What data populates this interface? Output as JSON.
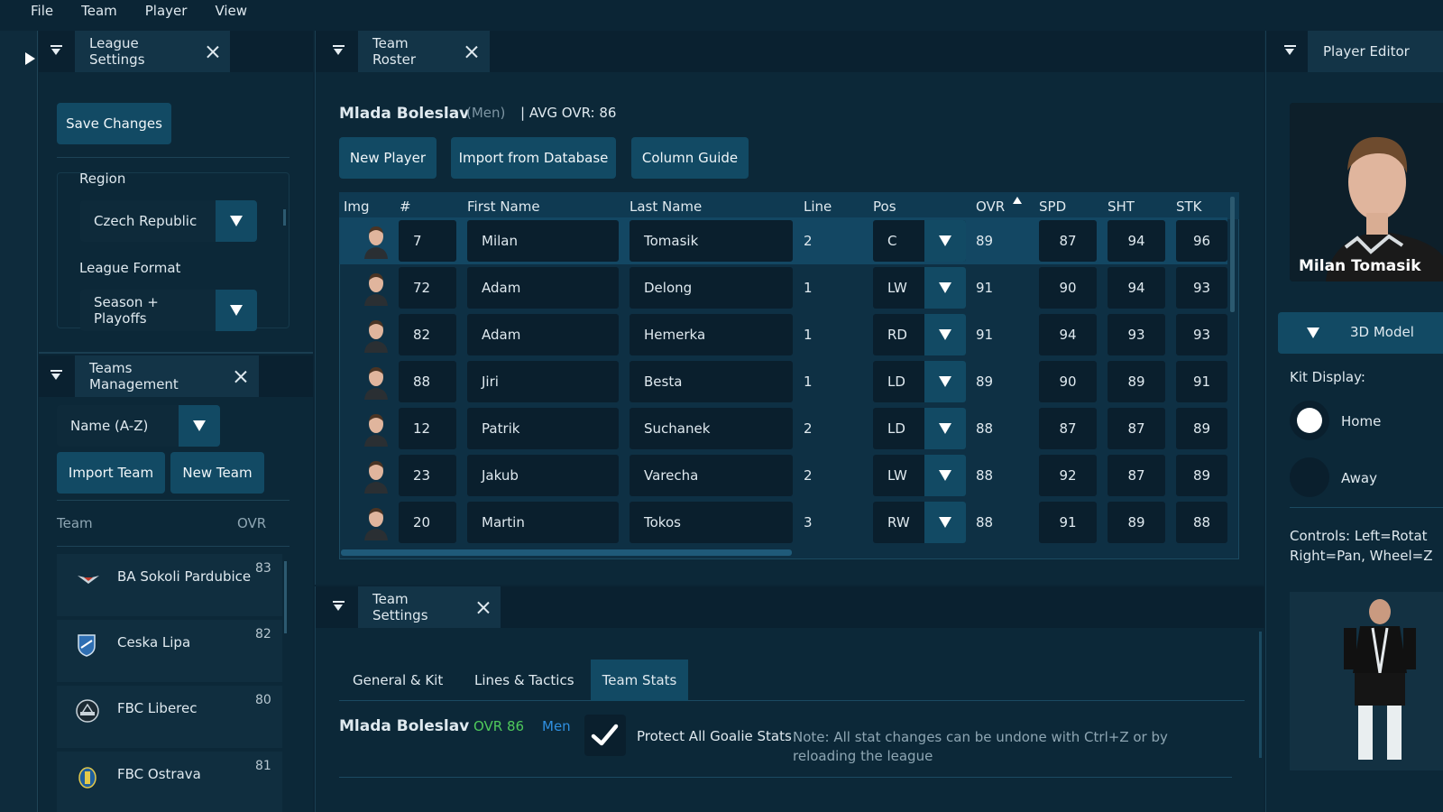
{
  "menu": [
    "File",
    "Team",
    "Player",
    "View"
  ],
  "league_panel": {
    "tab_label": "League Settings",
    "save_label": "Save Changes",
    "region_label": "Region",
    "region_value": "Czech Republic",
    "format_label": "League Format",
    "format_value": "Season + Playoffs"
  },
  "teams_panel": {
    "tab_label": "Teams Management",
    "sort_value": "Name (A-Z)",
    "import_label": "Import Team",
    "new_label": "New Team",
    "col_team": "Team",
    "col_ovr": "OVR",
    "teams": [
      {
        "name": "BA Sokoli Pardubice",
        "ovr": "83"
      },
      {
        "name": "Ceska Lipa",
        "ovr": "82"
      },
      {
        "name": "FBC Liberec",
        "ovr": "80"
      },
      {
        "name": "FBC Ostrava",
        "ovr": "81"
      }
    ]
  },
  "roster": {
    "tab_label": "Team Roster",
    "team_name": "Mlada Boleslav",
    "category": "(Men)",
    "avg_ovr": "| AVG OVR: 86",
    "new_player": "New Player",
    "import_db": "Import from Database",
    "column_guide": "Column Guide",
    "columns": {
      "img": "Img",
      "num": "#",
      "first": "First Name",
      "last": "Last Name",
      "line": "Line",
      "pos": "Pos",
      "ovr": "OVR",
      "spd": "SPD",
      "sht": "SHT",
      "stk": "STK"
    },
    "players": [
      {
        "num": "7",
        "first": "Milan",
        "last": "Tomasik",
        "line": "2",
        "pos": "C",
        "ovr": "89",
        "spd": "87",
        "sht": "94",
        "stk": "96"
      },
      {
        "num": "72",
        "first": "Adam",
        "last": "Delong",
        "line": "1",
        "pos": "LW",
        "ovr": "91",
        "spd": "90",
        "sht": "94",
        "stk": "93"
      },
      {
        "num": "82",
        "first": "Adam",
        "last": "Hemerka",
        "line": "1",
        "pos": "RD",
        "ovr": "91",
        "spd": "94",
        "sht": "93",
        "stk": "93"
      },
      {
        "num": "88",
        "first": "Jiri",
        "last": "Besta",
        "line": "1",
        "pos": "LD",
        "ovr": "89",
        "spd": "90",
        "sht": "89",
        "stk": "91"
      },
      {
        "num": "12",
        "first": "Patrik",
        "last": "Suchanek",
        "line": "2",
        "pos": "LD",
        "ovr": "88",
        "spd": "87",
        "sht": "87",
        "stk": "89"
      },
      {
        "num": "23",
        "first": "Jakub",
        "last": "Varecha",
        "line": "2",
        "pos": "LW",
        "ovr": "88",
        "spd": "92",
        "sht": "87",
        "stk": "89"
      },
      {
        "num": "20",
        "first": "Martin",
        "last": "Tokos",
        "line": "3",
        "pos": "RW",
        "ovr": "88",
        "spd": "91",
        "sht": "89",
        "stk": "88"
      }
    ]
  },
  "team_settings": {
    "tab_label": "Team Settings",
    "tabs": [
      "General & Kit",
      "Lines & Tactics",
      "Team Stats"
    ],
    "team_name": "Mlada Boleslav",
    "ovr": "OVR 86",
    "category": "Men",
    "protect_label": "Protect All Goalie Stats",
    "note": "Note: All stat changes can be undone with Ctrl+Z or by reloading the league"
  },
  "editor": {
    "tab_label": "Player Editor",
    "player_name": "Milan Tomasik",
    "model_label": "3D Model",
    "kit_label": "Kit Display:",
    "home": "Home",
    "away": "Away",
    "controls_1": "Controls: Left=Rotat",
    "controls_2": "Right=Pan, Wheel=Z"
  },
  "colors": {
    "accent": "#124a64",
    "green": "#4fc95b",
    "blue": "#2f8fe0"
  }
}
